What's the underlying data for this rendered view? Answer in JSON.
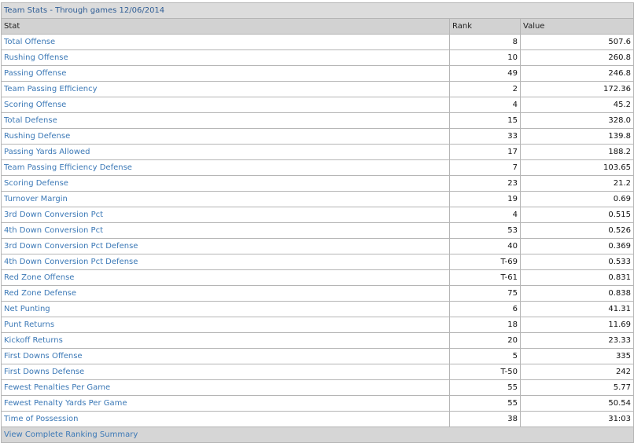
{
  "title": "Team Stats - Through games 12/06/2014",
  "headers": {
    "stat": "Stat",
    "rank": "Rank",
    "value": "Value"
  },
  "rows": [
    {
      "stat": "Total Offense",
      "rank": "8",
      "value": "507.6"
    },
    {
      "stat": "Rushing Offense",
      "rank": "10",
      "value": "260.8"
    },
    {
      "stat": "Passing Offense",
      "rank": "49",
      "value": "246.8"
    },
    {
      "stat": "Team Passing Efficiency",
      "rank": "2",
      "value": "172.36"
    },
    {
      "stat": "Scoring Offense",
      "rank": "4",
      "value": "45.2"
    },
    {
      "stat": "Total Defense",
      "rank": "15",
      "value": "328.0"
    },
    {
      "stat": "Rushing Defense",
      "rank": "33",
      "value": "139.8"
    },
    {
      "stat": "Passing Yards Allowed",
      "rank": "17",
      "value": "188.2"
    },
    {
      "stat": "Team Passing Efficiency Defense",
      "rank": "7",
      "value": "103.65"
    },
    {
      "stat": "Scoring Defense",
      "rank": "23",
      "value": "21.2"
    },
    {
      "stat": "Turnover Margin",
      "rank": "19",
      "value": "0.69"
    },
    {
      "stat": "3rd Down Conversion Pct",
      "rank": "4",
      "value": "0.515"
    },
    {
      "stat": "4th Down Conversion Pct",
      "rank": "53",
      "value": "0.526"
    },
    {
      "stat": "3rd Down Conversion Pct Defense",
      "rank": "40",
      "value": "0.369"
    },
    {
      "stat": "4th Down Conversion Pct Defense",
      "rank": "T-69",
      "value": "0.533"
    },
    {
      "stat": "Red Zone Offense",
      "rank": "T-61",
      "value": "0.831"
    },
    {
      "stat": "Red Zone Defense",
      "rank": "75",
      "value": "0.838"
    },
    {
      "stat": "Net Punting",
      "rank": "6",
      "value": "41.31"
    },
    {
      "stat": "Punt Returns",
      "rank": "18",
      "value": "11.69"
    },
    {
      "stat": "Kickoff Returns",
      "rank": "20",
      "value": "23.33"
    },
    {
      "stat": "First Downs Offense",
      "rank": "5",
      "value": "335"
    },
    {
      "stat": "First Downs Defense",
      "rank": "T-50",
      "value": "242"
    },
    {
      "stat": "Fewest Penalties Per Game",
      "rank": "55",
      "value": "5.77"
    },
    {
      "stat": "Fewest Penalty Yards Per Game",
      "rank": "55",
      "value": "50.54"
    },
    {
      "stat": "Time of Possession",
      "rank": "38",
      "value": "31:03"
    }
  ],
  "footer_link": "View Complete Ranking Summary"
}
